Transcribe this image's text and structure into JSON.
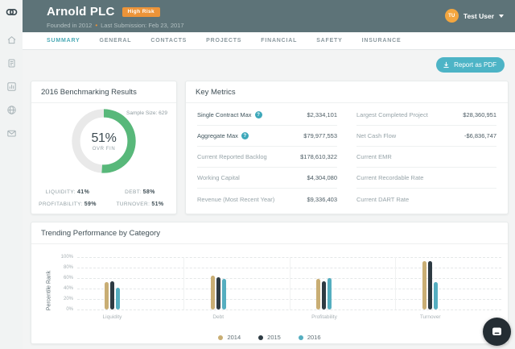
{
  "header": {
    "company_name": "Arnold PLC",
    "risk_badge": "High Risk",
    "founded": "Founded in 2012",
    "separator": "•",
    "last_submission": "Last Submission: Feb 23, 2017",
    "user": {
      "initials": "TU",
      "name": "Test User"
    }
  },
  "sidebar": {
    "icons": [
      "app-logo",
      "home-icon",
      "document-icon",
      "analytics-icon",
      "globe-icon",
      "mail-icon"
    ]
  },
  "tabs": [
    "SUMMARY",
    "GENERAL",
    "CONTACTS",
    "PROJECTS",
    "FINANCIAL",
    "SAFETY",
    "INSURANCE"
  ],
  "active_tab": "SUMMARY",
  "toolbar": {
    "report_button": "Report as PDF"
  },
  "colors": {
    "accent_teal": "#4db4c6",
    "risk_orange": "#ec9439",
    "header_slate": "#5d7378",
    "donut_green": "#58b87a"
  },
  "benchmarking": {
    "title": "2016 Benchmarking Results",
    "sample_size_label": "Sample Size: 629",
    "donut": {
      "percent": 51,
      "center_label": "51%",
      "center_sublabel": "OVR FIN",
      "color": "#58b87a",
      "track_color": "#e9e9e9"
    },
    "stats": [
      {
        "label": "Liquidity:",
        "value": "41%"
      },
      {
        "label": "Debt:",
        "value": "58%"
      },
      {
        "label": "Profitability:",
        "value": "59%"
      },
      {
        "label": "Turnover:",
        "value": "51%"
      }
    ]
  },
  "key_metrics": {
    "title": "Key Metrics",
    "help_glyph": "?",
    "left_rows": [
      {
        "label": "Single Contract Max",
        "value": "$2,334,101"
      },
      {
        "label": "Aggregate Max",
        "value": "$79,977,553"
      },
      {
        "label": "Current Reported Backlog",
        "value": "$178,610,322"
      },
      {
        "label": "Working Capital",
        "value": "$4,304,080"
      },
      {
        "label": "Revenue (Most Recent Year)",
        "value": "$9,336,403"
      }
    ],
    "right_rows": [
      {
        "label": "Largest Completed Project",
        "value": "$28,360,951"
      },
      {
        "label": "Net Cash Flow",
        "value": "-$6,836,747"
      },
      {
        "label": "Current EMR",
        "value": ""
      },
      {
        "label": "Current Recordable Rate",
        "value": ""
      },
      {
        "label": "Current DART Rate",
        "value": ""
      }
    ]
  },
  "chart_data": {
    "type": "bar",
    "title": "Trending Performance by Category",
    "ylabel": "Percentile Rank",
    "categories": [
      "Liquidity",
      "Debt",
      "Profitability",
      "Turnover"
    ],
    "series": [
      {
        "name": "2014",
        "color": "#c9ae74",
        "values": [
          52,
          65,
          59,
          92
        ]
      },
      {
        "name": "2015",
        "color": "#2e3b43",
        "values": [
          54,
          62,
          54,
          92
        ]
      },
      {
        "name": "2016",
        "color": "#55aec0",
        "values": [
          42,
          58,
          60,
          52
        ]
      }
    ],
    "y_ticks": [
      "100%",
      "80%",
      "60%",
      "40%",
      "20%",
      "0%"
    ],
    "ylim": [
      0,
      100
    ],
    "grid": true,
    "legend_position": "bottom"
  }
}
